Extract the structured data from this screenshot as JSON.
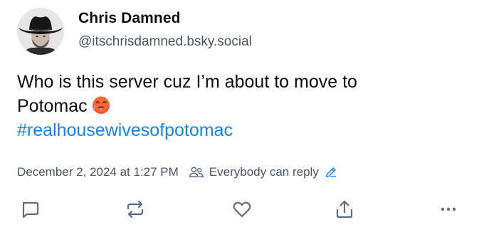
{
  "author": {
    "display_name": "Chris Damned",
    "handle": "@itschrisdamned.bsky.social",
    "avatar_icon": "avatar-cowboy-hat"
  },
  "post": {
    "line1": "Who is this server cuz I’m about to move to",
    "line2": "Potomac",
    "emoji": "hot-face-emoji",
    "hashtag": "#realhousewivesofpotomac"
  },
  "meta": {
    "timestamp": "December 2, 2024 at 1:27 PM",
    "reply_setting": "Everybody can reply"
  },
  "actions": {
    "icons": [
      "reply-icon",
      "repost-icon",
      "like-icon",
      "share-icon",
      "more-icon"
    ]
  },
  "colors": {
    "text": "#0b0f14",
    "muted": "#475569",
    "link": "#1083fe",
    "icon": "#5b6b82"
  }
}
